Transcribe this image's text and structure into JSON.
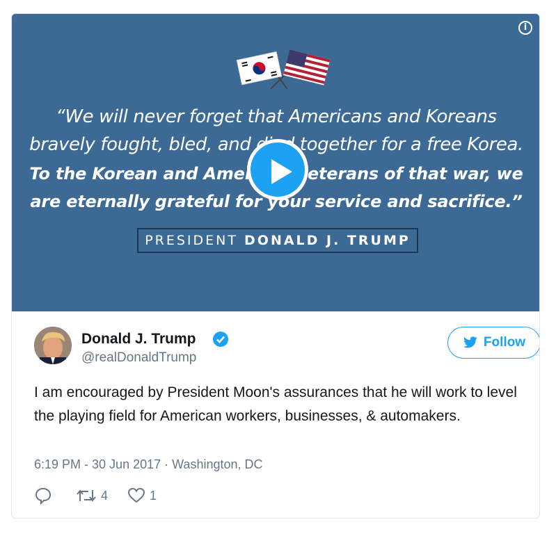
{
  "media": {
    "quote_line1": "“We will never forget that Americans and Koreans",
    "quote_line2": "bravely fought, bled, and died together for a free Korea.",
    "quote_line3": "To the Korean and American veterans of that war, we",
    "quote_line4": "are eternally grateful for your service and sacrifice.”",
    "byline_prefix": "PRESIDENT",
    "byline_name": "DONALD J. TRUMP",
    "background_color": "#3d6a95",
    "accent_color": "#1da1f2"
  },
  "author": {
    "name": "Donald J. Trump",
    "handle": "@realDonaldTrump",
    "verified_icon": "verified-badge-icon"
  },
  "follow": {
    "label": "Follow"
  },
  "tweet": {
    "text": "I am encouraged by President Moon's assurances that he will work to level the playing field for American workers, businesses, & automakers.",
    "meta": "6:19 PM - 30 Jun 2017 · Washington, DC"
  },
  "actions": {
    "reply_icon": "reply-icon",
    "retweet_count": "4",
    "like_count": "1"
  }
}
